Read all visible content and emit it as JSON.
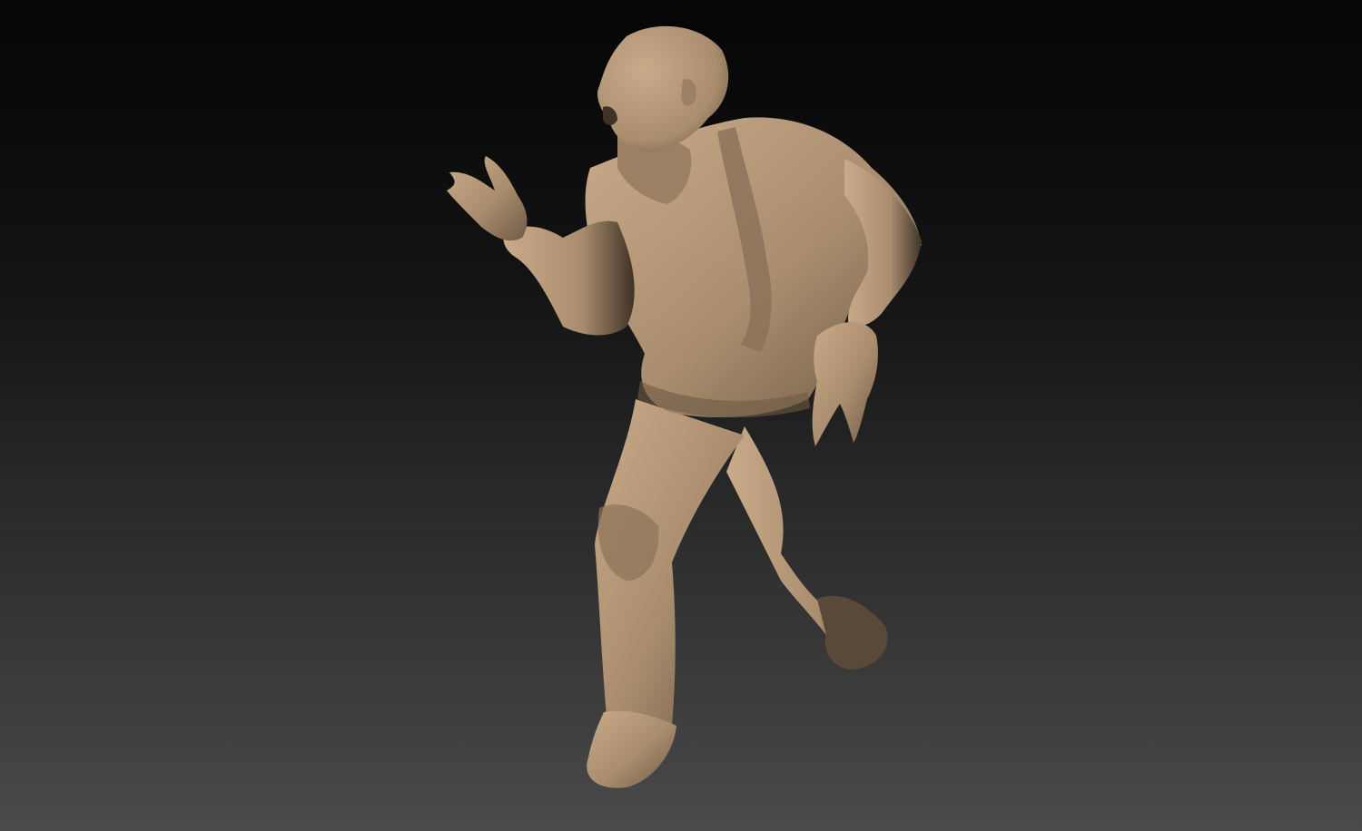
{
  "scene": {
    "subject": "sculpted-figure",
    "colors": {
      "background_top": "#050505",
      "background_bottom": "#4a4a4b",
      "clay_light": "#c9ab8a",
      "clay_mid": "#a98d6e",
      "clay_dark": "#6e5a45",
      "clay_shadow": "#3f3226"
    }
  }
}
